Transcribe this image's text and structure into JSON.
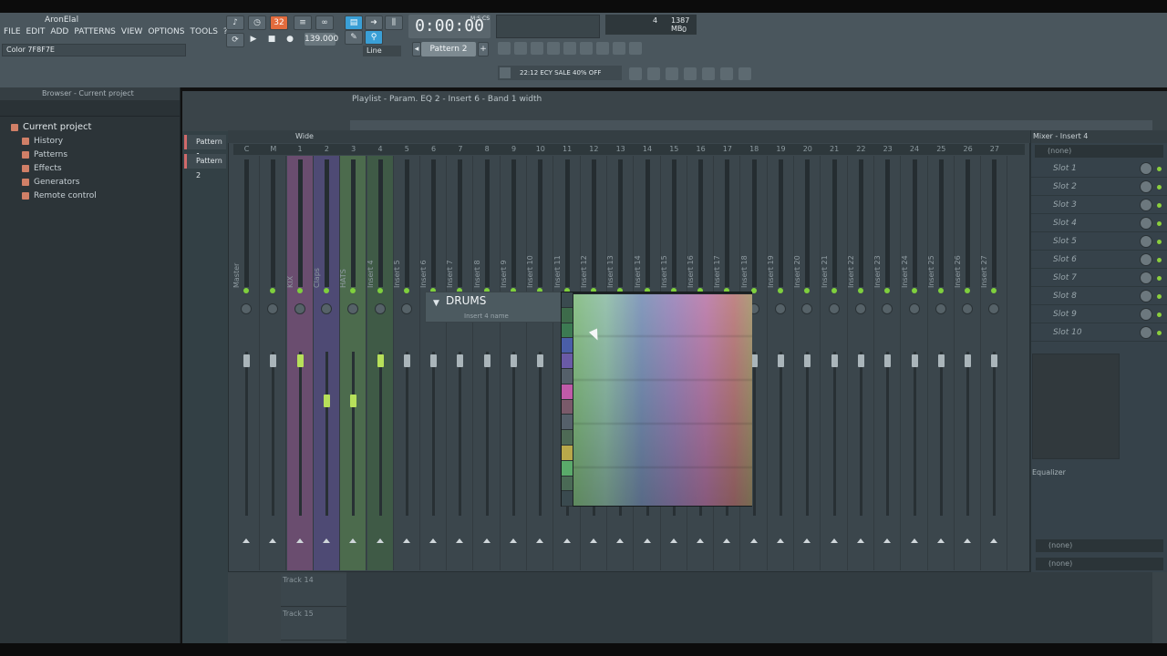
{
  "app": {
    "title": "AronElal"
  },
  "menu": [
    "FILE",
    "EDIT",
    "ADD",
    "PATTERNS",
    "VIEW",
    "OPTIONS",
    "TOOLS",
    "?"
  ],
  "hint": "Color 7F8F7E",
  "transport": {
    "time": "0:00:00",
    "time_small": "M:S:CS",
    "bpm": "139.000",
    "pattern": "Pattern 2",
    "snap": "Line",
    "step_label": "32"
  },
  "cpu": {
    "cpu_val": "4",
    "mem": "1387 MB",
    "voices": "0"
  },
  "news": {
    "time": "22:12",
    "text": "ECY SALE 40% OFF"
  },
  "browser": {
    "title": "Browser - Current project",
    "root": "Current project",
    "items": [
      "History",
      "Patterns",
      "Effects",
      "Generators",
      "Remote control"
    ]
  },
  "playlist": {
    "title": "Playlist - Param. EQ 2 - Insert 6 - Band 1 width",
    "patterns": [
      "Pattern 1",
      "Pattern 2"
    ],
    "tracks": [
      "Track 14",
      "Track 15"
    ]
  },
  "mixer": {
    "preset": "Wide",
    "strips": [
      {
        "num": "C",
        "name": "Master"
      },
      {
        "num": "M",
        "name": ""
      },
      {
        "num": "1",
        "name": "KIX"
      },
      {
        "num": "2",
        "name": "Claps"
      },
      {
        "num": "3",
        "name": "HATS"
      },
      {
        "num": "4",
        "name": "Insert 4"
      },
      {
        "num": "5",
        "name": "Insert 5"
      },
      {
        "num": "6",
        "name": "Insert 6"
      },
      {
        "num": "7",
        "name": "Insert 7"
      },
      {
        "num": "8",
        "name": "Insert 8"
      },
      {
        "num": "9",
        "name": "Insert 9"
      },
      {
        "num": "10",
        "name": "Insert 10"
      },
      {
        "num": "11",
        "name": "Insert 11"
      },
      {
        "num": "12",
        "name": "Insert 12"
      },
      {
        "num": "13",
        "name": "Insert 13"
      },
      {
        "num": "14",
        "name": "Insert 14"
      },
      {
        "num": "15",
        "name": "Insert 15"
      },
      {
        "num": "16",
        "name": "Insert 16"
      },
      {
        "num": "17",
        "name": "Insert 17"
      },
      {
        "num": "18",
        "name": "Insert 18"
      },
      {
        "num": "19",
        "name": "Insert 19"
      },
      {
        "num": "20",
        "name": "Insert 20"
      },
      {
        "num": "21",
        "name": "Insert 21"
      },
      {
        "num": "22",
        "name": "Insert 22"
      },
      {
        "num": "23",
        "name": "Insert 23"
      },
      {
        "num": "24",
        "name": "Insert 24"
      },
      {
        "num": "25",
        "name": "Insert 25"
      },
      {
        "num": "26",
        "name": "Insert 26"
      },
      {
        "num": "27",
        "name": "Insert 27"
      }
    ]
  },
  "rename": {
    "value": "DRUMS",
    "subtitle": "Insert 4 name"
  },
  "insert_panel": {
    "title": "Mixer - Insert 4",
    "top_field": "(none)",
    "slots": [
      "Slot 1",
      "Slot 2",
      "Slot 3",
      "Slot 4",
      "Slot 5",
      "Slot 6",
      "Slot 7",
      "Slot 8",
      "Slot 9",
      "Slot 10"
    ],
    "eq_label": "Equalizer",
    "bottom_field_1": "(none)",
    "bottom_field_2": "(none)"
  },
  "colors": {
    "accent_orange": "#e26b3d",
    "accent_blue": "#3a9fd6",
    "led_green": "#8bcf3d",
    "strip_kix": "#6a4d6f",
    "strip_claps": "#4e4a74",
    "strip_hats": "#4c6b4d",
    "swatches": [
      "#3a4a4f",
      "#3d6b4a",
      "#3c7a52",
      "#4a5ea8",
      "#6a5aa6",
      "#55606a",
      "#c05aa8",
      "#7a5a6a",
      "#55606a",
      "#4e6a55",
      "#b8a84a",
      "#5aaa6a",
      "#4a6a55",
      "#3a4a4f"
    ]
  }
}
